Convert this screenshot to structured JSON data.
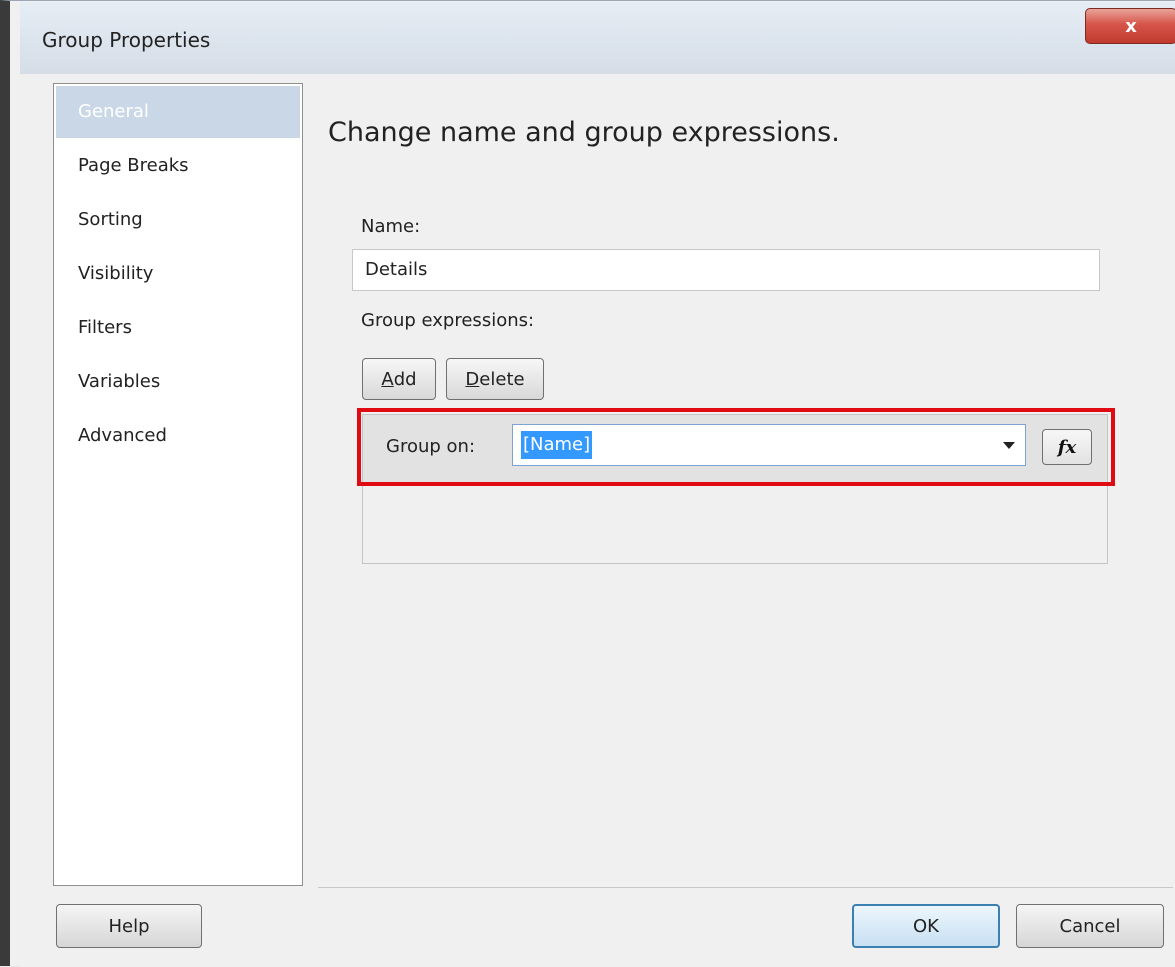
{
  "window": {
    "title": "Group Properties",
    "close_symbol": "x"
  },
  "nav": {
    "items": [
      {
        "label": "General",
        "selected": true
      },
      {
        "label": "Page Breaks"
      },
      {
        "label": "Sorting"
      },
      {
        "label": "Visibility"
      },
      {
        "label": "Filters"
      },
      {
        "label": "Variables"
      },
      {
        "label": "Advanced"
      }
    ]
  },
  "main": {
    "heading": "Change name and group expressions.",
    "name_label": "Name:",
    "name_value": "Details",
    "group_expressions_label": "Group expressions:",
    "add_button": {
      "mnemonic": "A",
      "rest": "dd"
    },
    "delete_button": {
      "mnemonic": "D",
      "rest": "elete"
    },
    "group_on_label": "Group on:",
    "group_on_value": "[Name]",
    "fx_label": "fx"
  },
  "footer": {
    "help_label": "Help",
    "ok_label": "OK",
    "cancel_label": "Cancel"
  },
  "colors": {
    "highlight_border": "#e00a12",
    "selection": "#3399ff",
    "nav_selected": "#c9d7e6"
  }
}
